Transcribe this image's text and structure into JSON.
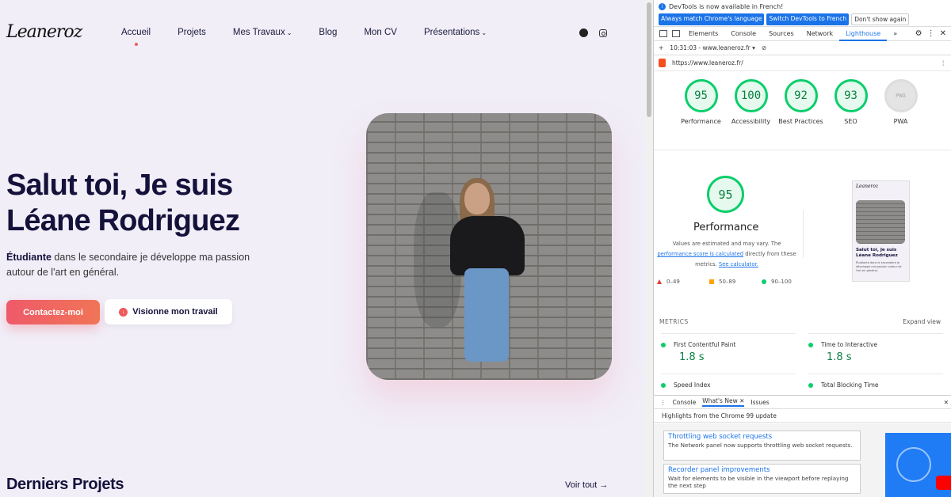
{
  "site": {
    "logo": "Leaneroz",
    "nav": [
      {
        "label": "Accueil",
        "dropdown": false,
        "active": true
      },
      {
        "label": "Projets",
        "dropdown": false
      },
      {
        "label": "Mes Travaux",
        "dropdown": true
      },
      {
        "label": "Blog",
        "dropdown": false
      },
      {
        "label": "Mon CV",
        "dropdown": false
      },
      {
        "label": "Présentations",
        "dropdown": true
      }
    ],
    "social": [
      "github-icon",
      "instagram-icon"
    ],
    "hero": {
      "title_line1": "Salut toi, Je suis",
      "title_line2": "Léane Rodriguez",
      "sub_strong": "Étudiante",
      "sub_rest": " dans le secondaire je développe ma passion autour de l'art en général.",
      "contact_label": "Contactez-moi",
      "work_label": "Visionne mon travail"
    },
    "projects_title": "Derniers Projets",
    "see_all": "Voir tout",
    "see_all_arrow": "→",
    "accent": "#ef5a6a"
  },
  "devtools": {
    "info_text": "DevTools is now available in French!",
    "info_btn1": "Always match Chrome's language",
    "info_btn2": "Switch DevTools to French",
    "info_btn3": "Don't show again",
    "tabs": [
      "Elements",
      "Console",
      "Sources",
      "Network",
      "Lighthouse"
    ],
    "active_tab": "Lighthouse",
    "tab_more": "»",
    "report_time": "10:31:03 - www.leaneroz.fr",
    "add_icon": "+",
    "dropdown_arrow": "▾",
    "clear_icon": "⊘",
    "url": "https://www.leaneroz.fr/",
    "kebab": "⋮",
    "gear": "⚙",
    "close": "✕",
    "scores": [
      {
        "label": "Performance",
        "value": "95"
      },
      {
        "label": "Accessibility",
        "value": "100"
      },
      {
        "label": "Best Practices",
        "value": "92"
      },
      {
        "label": "SEO",
        "value": "93"
      },
      {
        "label": "PWA",
        "value": "PWA"
      }
    ],
    "perf": {
      "score": "95",
      "title": "Performance",
      "desc_pre": "Values are estimated and may vary. The ",
      "desc_link1": "performance score is calculated",
      "desc_mid": " directly from these metrics. ",
      "desc_link2": "See calculator.",
      "legend": [
        "0–49",
        "50–89",
        "90–100"
      ]
    },
    "thumbnail": {
      "logo": "Leaneroz",
      "title": "Salut toi, Je suis Léane Rodriguez",
      "text": "Étudiante dans le secondaire je développe ma passion autour de l'art en général."
    },
    "metrics_label": "METRICS",
    "expand_label": "Expand view",
    "metrics": [
      {
        "name": "First Contentful Paint",
        "value": "1.8 s"
      },
      {
        "name": "Time to Interactive",
        "value": "1.8 s"
      },
      {
        "name": "Speed Index",
        "value": ""
      },
      {
        "name": "Total Blocking Time",
        "value": ""
      }
    ],
    "drawer_tabs": [
      "Console",
      "What's New",
      "Issues"
    ],
    "drawer_active": "What's New",
    "drawer_headline": "Highlights from the Chrome 99 update",
    "news": [
      {
        "title": "Throttling web socket requests",
        "desc": "The Network panel now supports throttling web socket requests."
      },
      {
        "title": "Recorder panel improvements",
        "desc": "Wait for elements to be visible in the viewport before replaying the next step"
      }
    ],
    "score_color": "#0cce6b",
    "link_color": "#1a73e8"
  }
}
